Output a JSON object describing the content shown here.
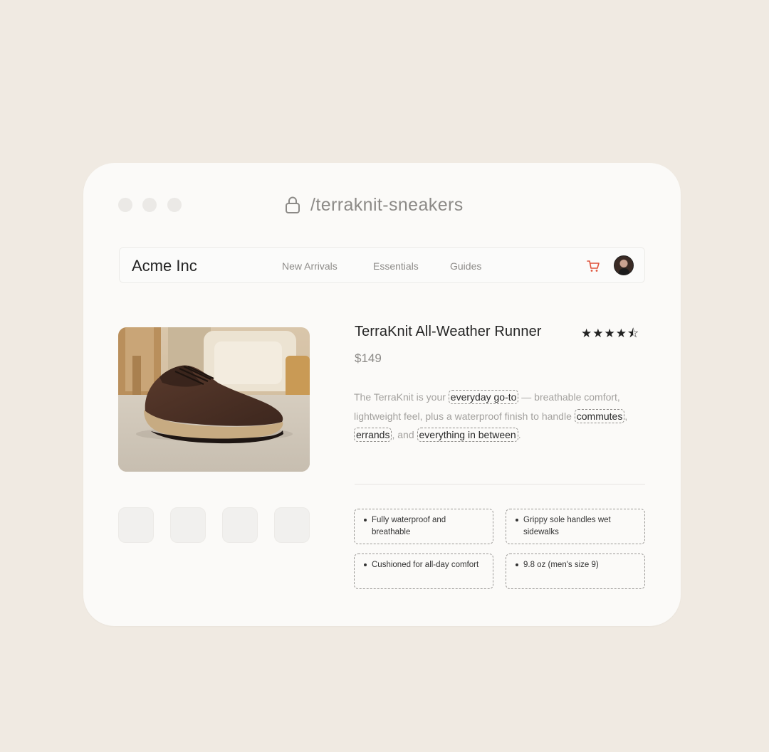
{
  "browser": {
    "url_path": "/terraknit-sneakers"
  },
  "navbar": {
    "brand": "Acme Inc",
    "links": [
      "New Arrivals",
      "Essentials",
      "Guides"
    ]
  },
  "product": {
    "title": "TerraKnit All-Weather Runner",
    "price": "$149",
    "rating_stars": "★★★★⯪",
    "rating_value": 4.5,
    "rating_max": 5,
    "description": {
      "t1": "The TerraKnit is your ",
      "h1": "everyday go-to",
      "t2": " — breathable comfort, lightweight feel, plus a waterproof finish to handle ",
      "h2": "commutes",
      "t3": ", ",
      "h3": "errands",
      "t4": ", and ",
      "h4": "everything in between",
      "t5": "."
    },
    "features": [
      "Fully waterproof and breathable",
      "Grippy sole handles wet sidewalks",
      "Cushioned for all-day comfort",
      "9.8 oz (men's size 9)"
    ]
  },
  "colors": {
    "background": "#f0eae2",
    "window": "#fbfaf8",
    "cart_accent": "#e0533a"
  }
}
